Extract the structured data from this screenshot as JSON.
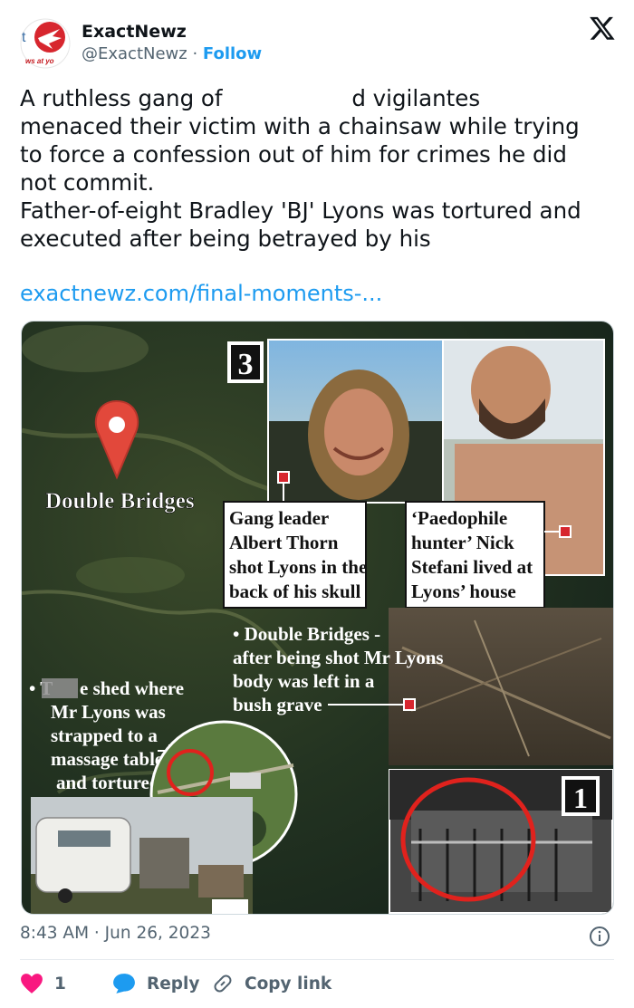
{
  "author": {
    "name": "ExactNewz",
    "handle": "@ExactNewz",
    "separator": " · ",
    "follow_label": "Follow",
    "avatar_text": "ws at yo",
    "avatar_letter": "t"
  },
  "tweet": {
    "line1_a": "A ruthless gang of ",
    "line1_b": "d vigilantes",
    "rest": "menaced their victim with a chainsaw while trying\nto force a confession out of him for crimes he did\nnot commit.\nFather-of-eight Bradley 'BJ' Lyons was tortured and\nexecuted after being betrayed by his",
    "link": "exactnewz.com/final-moments-..."
  },
  "media": {
    "map_label": "Double Bridges",
    "panel_3_number": "3",
    "panel_1_number": "1",
    "caption_thorn": [
      "Gang leader",
      "Albert Thorn",
      "shot Lyons in the",
      "back of his skull"
    ],
    "caption_stefani": [
      "‘Paedophile",
      "hunter’ Nick",
      "Stefani lived at",
      "Lyons’ house"
    ],
    "caption_grave": [
      "• Double Bridges -",
      "after being shot Mr Lyons",
      "body was left in a",
      "bush grave"
    ],
    "caption_shed": [
      "• T",
      "e shed where",
      "Mr Lyons was",
      "strapped to a",
      "massage table",
      "and tortured"
    ]
  },
  "meta": {
    "timestamp": "8:43 AM · Jun 26, 2023"
  },
  "actions": {
    "like_count": "1",
    "reply_label": "Reply",
    "copy_label": "Copy link"
  },
  "colors": {
    "accent": "#1d9bf0",
    "like": "#f91880",
    "text": "#0f1419",
    "muted": "#536471"
  }
}
